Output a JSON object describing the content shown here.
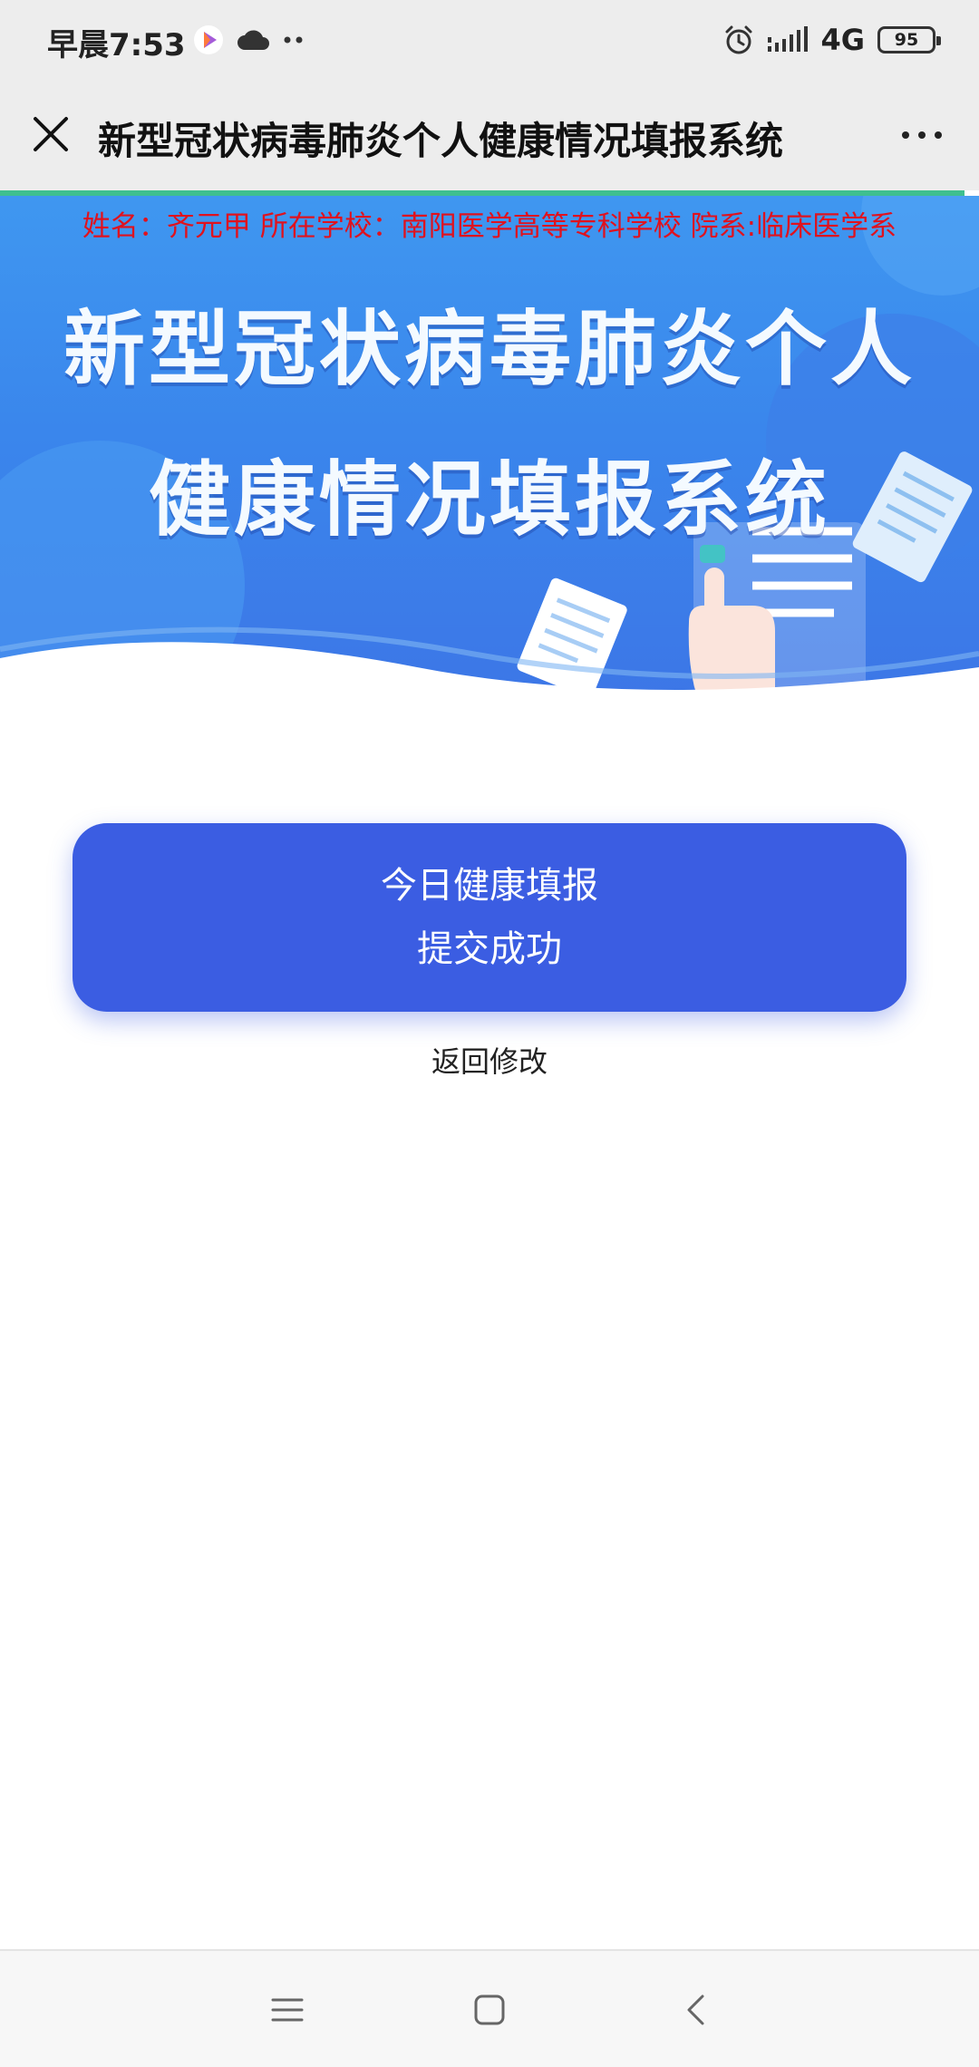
{
  "status": {
    "time": "早晨7:53",
    "network": "4G",
    "battery": "95"
  },
  "titlebar": {
    "title": "新型冠状病毒肺炎个人健康情况填报系统"
  },
  "banner": {
    "info_line": "姓名：齐元甲 所在学校：南阳医学高等专科学校 院系:临床医学系",
    "title_line1": "新型冠状病毒肺炎个人",
    "title_line2": "健康情况填报系统"
  },
  "result": {
    "line1": "今日健康填报",
    "line2": "提交成功"
  },
  "actions": {
    "back_edit": "返回修改"
  },
  "colors": {
    "primary": "#3b5de2",
    "info_text": "#e0121e",
    "banner_blue": "#3a86ec"
  }
}
